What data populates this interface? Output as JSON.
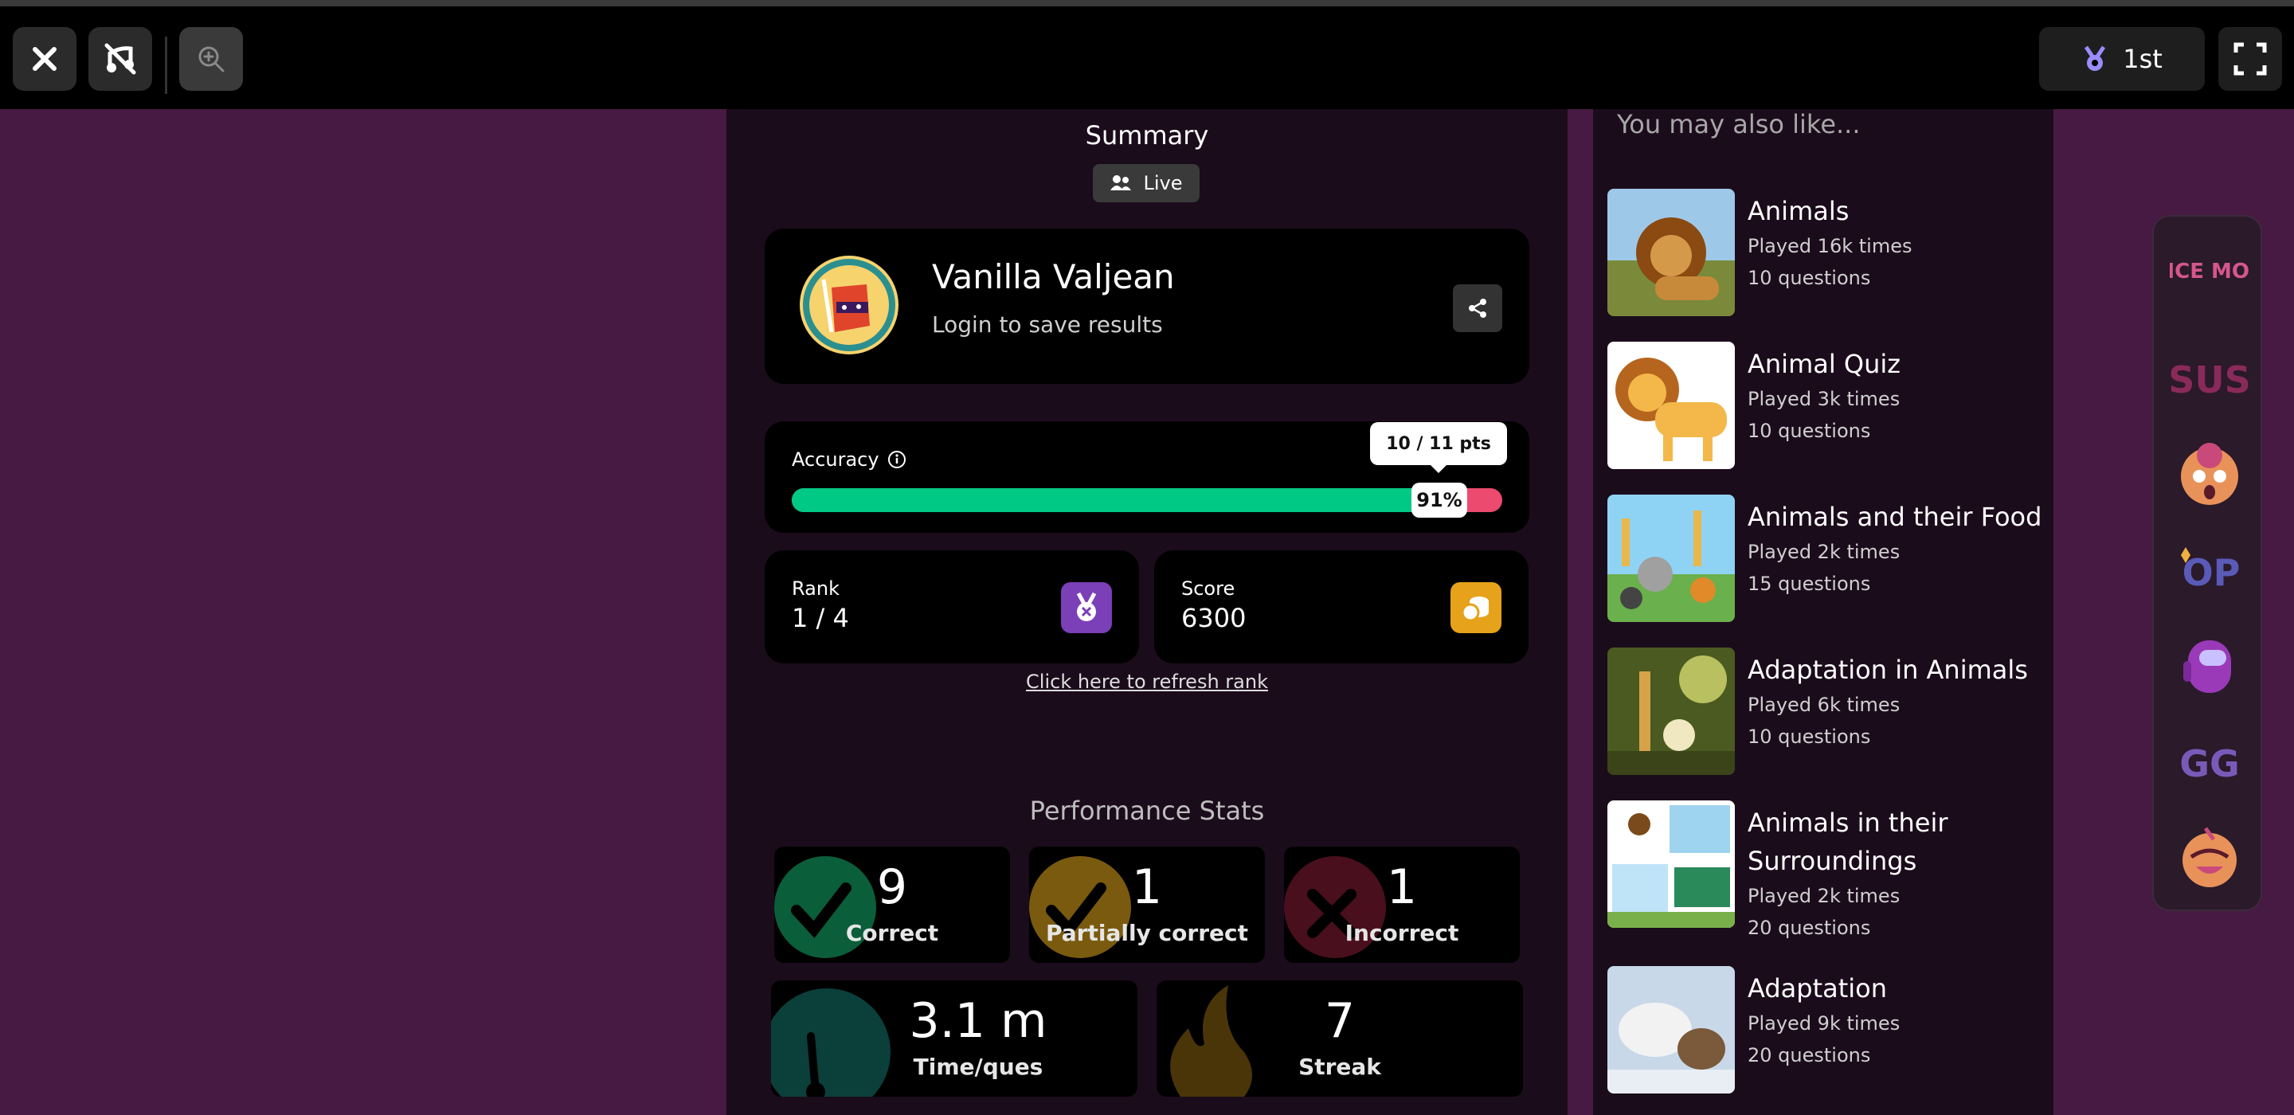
{
  "topbar": {
    "close_icon": "close-icon",
    "rank_label": "1st"
  },
  "summary": {
    "title": "Summary",
    "live_label": "Live"
  },
  "profile": {
    "name": "Vanilla Valjean",
    "subtitle": "Login to save results"
  },
  "accuracy": {
    "label": "Accuracy",
    "percent_label": "91%",
    "percent": 91,
    "points_label": "10 / 11 pts"
  },
  "rank": {
    "label": "Rank",
    "value": "1 / 4"
  },
  "score": {
    "label": "Score",
    "value": "6300"
  },
  "refresh_label": "Click here to refresh rank",
  "performance": {
    "title": "Performance Stats",
    "correct": {
      "value": "9",
      "label": "Correct"
    },
    "partial": {
      "value": "1",
      "label": "Partially correct"
    },
    "incorrect": {
      "value": "1",
      "label": "Incorrect"
    },
    "time": {
      "value": "3.1 m",
      "label": "Time/ques"
    },
    "streak": {
      "value": "7",
      "label": "Streak"
    }
  },
  "sidebar": {
    "title": "You may also like...",
    "items": [
      {
        "title": "Animals",
        "played": "Played 16k times",
        "questions": "10 questions"
      },
      {
        "title": "Animal Quiz",
        "played": "Played 3k times",
        "questions": "10 questions"
      },
      {
        "title": "Animals and their Food",
        "played": "Played 2k times",
        "questions": "15 questions"
      },
      {
        "title": "Adaptation in Animals",
        "played": "Played 6k times",
        "questions": "10 questions"
      },
      {
        "title": "Animals in their Surroundings",
        "played": "Played 2k times",
        "questions": "20 questions"
      },
      {
        "title": "Adaptation",
        "played": "Played 9k times",
        "questions": "20 questions"
      }
    ]
  },
  "stickers": {
    "once_more": "ONCE MORE",
    "sus": "SUS",
    "op": "OP",
    "gg": "GG"
  },
  "colors": {
    "background": "#461a42",
    "panel": "#1b0c1b",
    "correct": "#00c985",
    "incorrect": "#ec4a6e",
    "rank_icon_bg": "#7b3fb8",
    "score_icon_bg": "#e6a21a"
  }
}
